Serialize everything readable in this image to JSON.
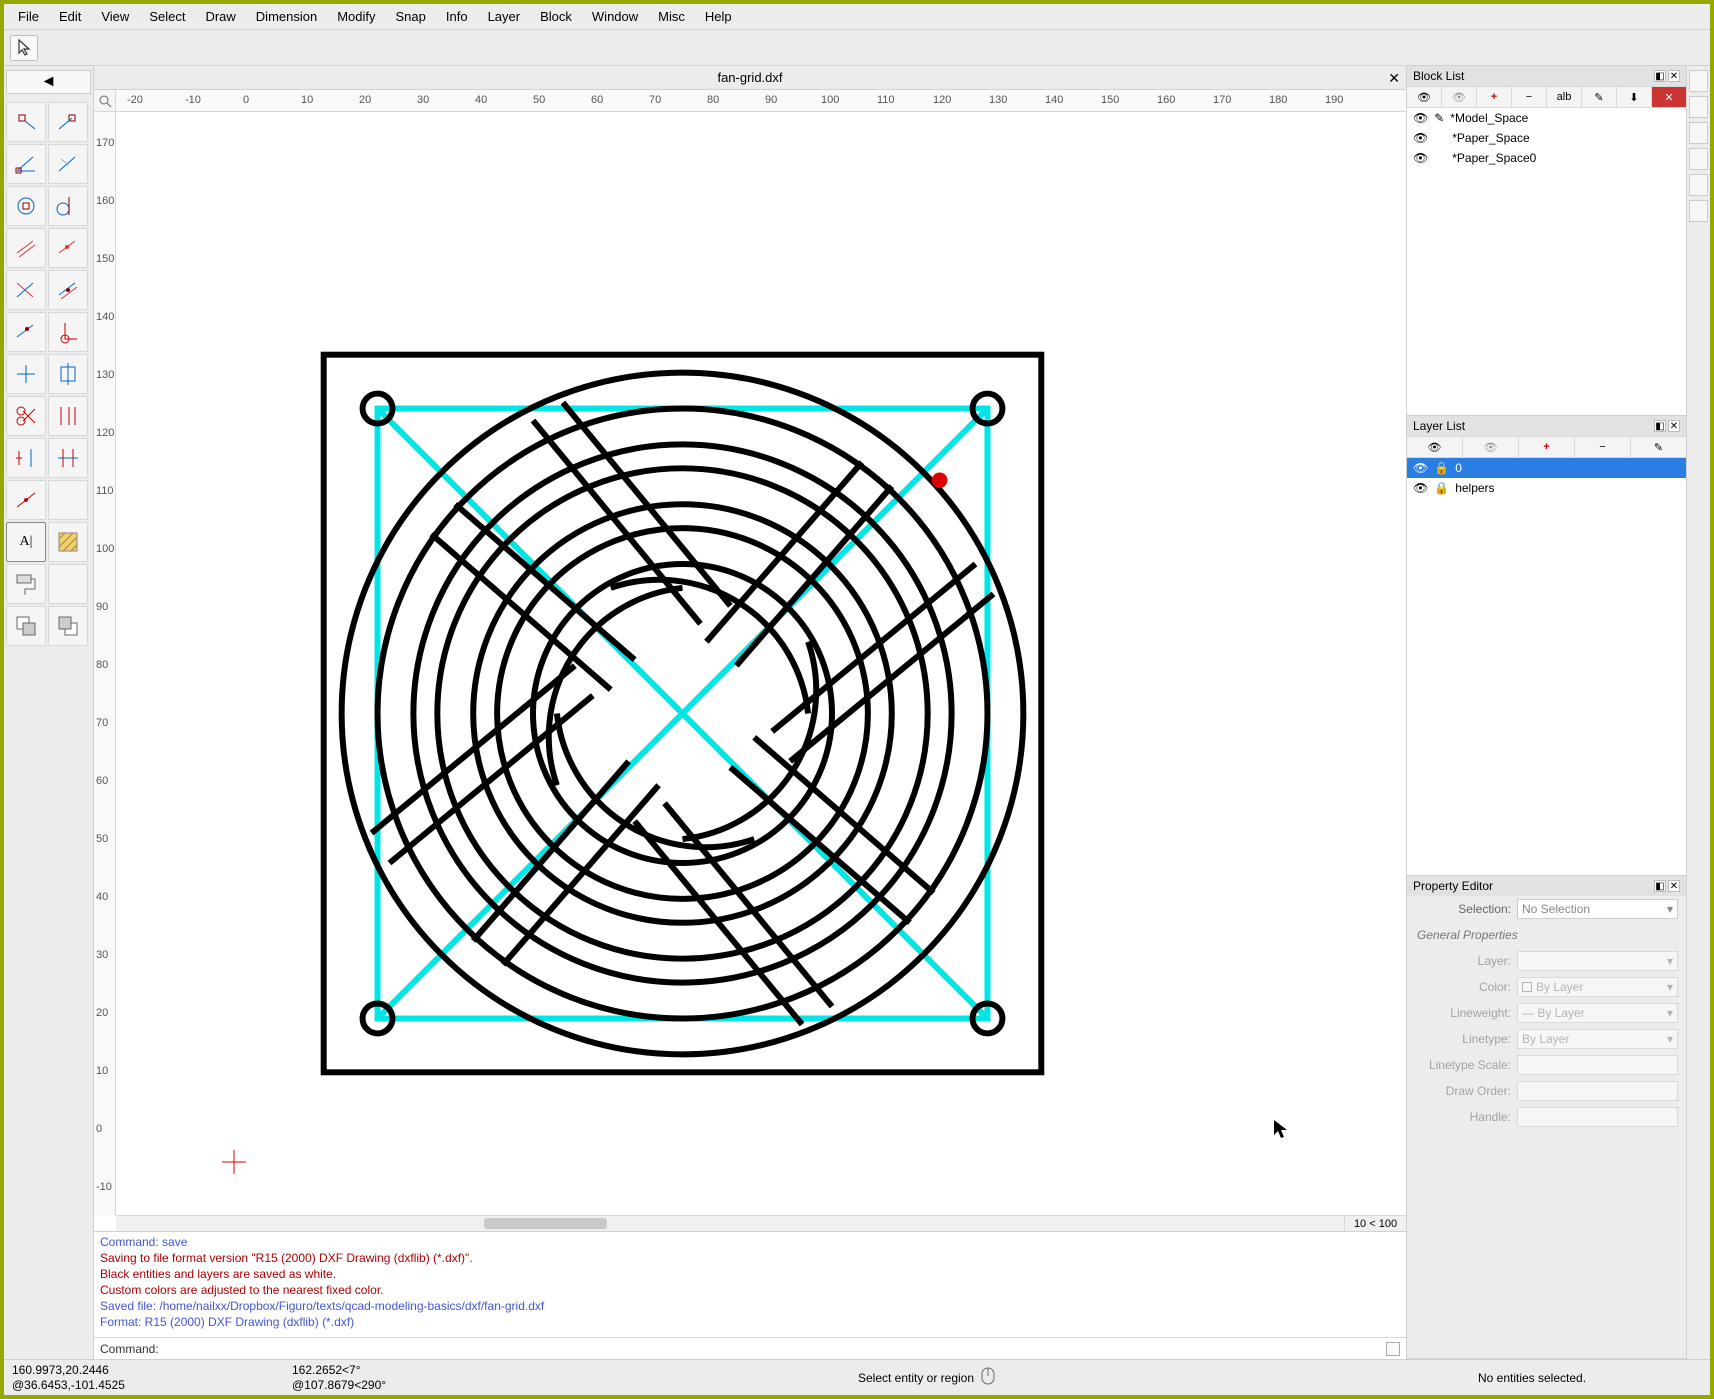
{
  "menu": {
    "items": [
      "File",
      "Edit",
      "View",
      "Select",
      "Draw",
      "Dimension",
      "Modify",
      "Snap",
      "Info",
      "Layer",
      "Block",
      "Window",
      "Misc",
      "Help"
    ]
  },
  "document": {
    "filename": "fan-grid.dxf"
  },
  "ruler": {
    "h_ticks": [
      "-20",
      "-10",
      "0",
      "10",
      "20",
      "30",
      "40",
      "50",
      "60",
      "70",
      "80",
      "90",
      "100",
      "110",
      "120",
      "130",
      "140",
      "150",
      "160",
      "170",
      "180",
      "190"
    ],
    "v_ticks": [
      "-10",
      "0",
      "10",
      "20",
      "30",
      "40",
      "50",
      "60",
      "70",
      "80",
      "90",
      "100",
      "110",
      "120",
      "130",
      "140",
      "150",
      "160",
      "170"
    ]
  },
  "zoom": {
    "label": "10 < 100"
  },
  "block_list": {
    "title": "Block List",
    "toolbar_text": "alb",
    "items": [
      {
        "name": "*Model_Space",
        "has_pencil": true
      },
      {
        "name": "*Paper_Space",
        "has_pencil": false
      },
      {
        "name": "*Paper_Space0",
        "has_pencil": false
      }
    ]
  },
  "layer_list": {
    "title": "Layer List",
    "items": [
      {
        "name": "0",
        "selected": true,
        "locked": true
      },
      {
        "name": "helpers",
        "selected": false,
        "locked": true
      }
    ]
  },
  "property_editor": {
    "title": "Property Editor",
    "selection_label": "Selection:",
    "selection_value": "No Selection",
    "section_general": "General Properties",
    "rows": [
      {
        "label": "Layer:",
        "value": ""
      },
      {
        "label": "Color:",
        "value": "By Layer"
      },
      {
        "label": "Lineweight:",
        "value": "By Layer"
      },
      {
        "label": "Linetype:",
        "value": "By Layer"
      },
      {
        "label": "Linetype Scale:",
        "value": ""
      },
      {
        "label": "Draw Order:",
        "value": ""
      },
      {
        "label": "Handle:",
        "value": ""
      }
    ]
  },
  "console": {
    "messages": [
      {
        "text": "Command: save",
        "cls": "blue"
      },
      {
        "text": "Saving to file format version \"R15 (2000) DXF Drawing (dxflib) (*.dxf)\".",
        "cls": "red"
      },
      {
        "text": "Black entities and layers are saved as white.",
        "cls": "red"
      },
      {
        "text": "Custom colors are adjusted to the nearest fixed color.",
        "cls": "red"
      },
      {
        "text": "Saved file: /home/nailxx/Dropbox/Figuro/texts/qcad-modeling-basics/dxf/fan-grid.dxf",
        "cls": "blue"
      },
      {
        "text": "Format: R15 (2000) DXF Drawing (dxflib) (*.dxf)",
        "cls": "blue"
      }
    ],
    "command_label": "Command:"
  },
  "status": {
    "abs_coord": "160.9973,20.2446",
    "rel_coord": "@36.6453,-101.4525",
    "polar_abs": "162.2652<7°",
    "polar_rel": "@107.8679<290°",
    "hint": "Select entity or region",
    "right": "No entities selected."
  }
}
